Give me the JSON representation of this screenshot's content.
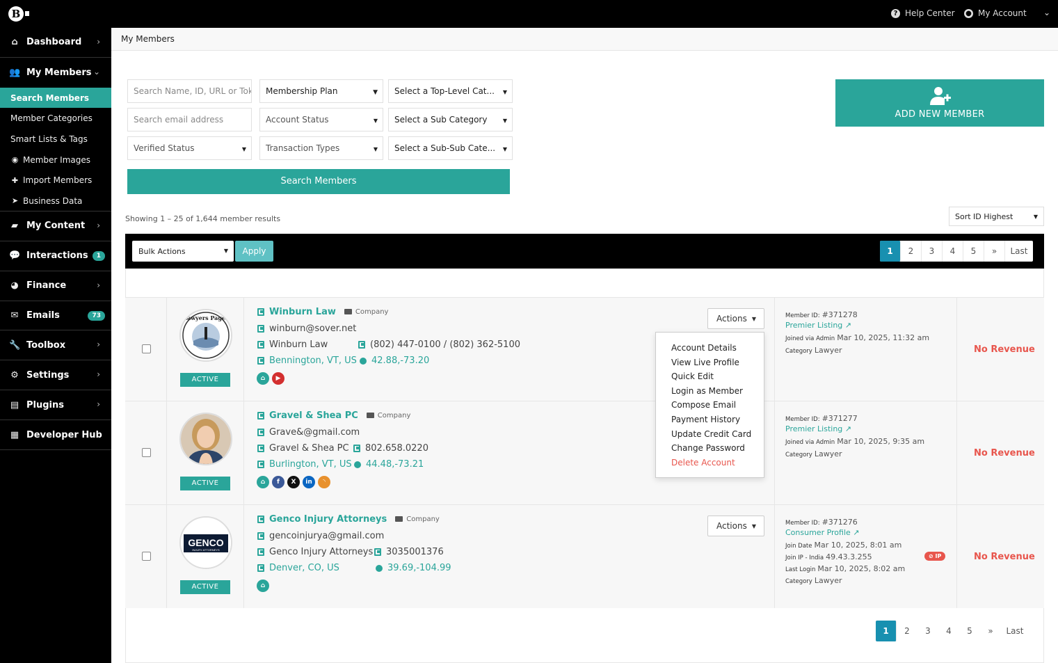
{
  "topbar": {
    "help": "Help Center",
    "account": "My Account"
  },
  "sidebar": {
    "dashboard": "Dashboard",
    "my_members": "My Members",
    "sub": [
      "Search Members",
      "Member Categories",
      "Smart Lists & Tags",
      "Member Images",
      "Import Members",
      "Business Data"
    ],
    "my_content": "My Content",
    "interactions": "Interactions",
    "interactions_badge": "1",
    "finance": "Finance",
    "emails": "Emails",
    "emails_badge": "73",
    "toolbox": "Toolbox",
    "settings": "Settings",
    "plugins": "Plugins",
    "developer_hub": "Developer Hub"
  },
  "breadcrumb": "My Members",
  "filters": {
    "search_placeholder": "Search Name, ID, URL or Tok",
    "email_placeholder": "Search email address",
    "verified": "Verified Status",
    "plan": "Membership Plan",
    "account_status": "Account Status",
    "transaction": "Transaction Types",
    "top_cat": "Select a Top-Level Cat...",
    "sub_cat": "Select a Sub Category",
    "subsub_cat": "Select a Sub-Sub Cate...",
    "search_button": "Search Members"
  },
  "add_member": "ADD NEW MEMBER",
  "showing": "Showing 1 – 25 of 1,644 member results",
  "sort": "Sort ID Highest",
  "bulk": "Bulk Actions",
  "apply": "Apply",
  "pagination": [
    "1",
    "2",
    "3",
    "4",
    "5",
    "»",
    "Last"
  ],
  "members": [
    {
      "name": "Winburn Law",
      "type": "Company",
      "email": "winburn@sover.net",
      "company": "Winburn Law",
      "phone": "(802) 447-0100 / (802) 362-5100",
      "location": "Bennington, VT, US",
      "coords": "42.88,-73.20",
      "status": "ACTIVE",
      "actions": "Actions",
      "member_id": "#371278",
      "plan": "Premier Listing",
      "joined_label": "Joined via Admin",
      "joined": "Mar 10, 2025, 11:32 am",
      "category_label": "Category",
      "category": "Lawyer",
      "revenue": "No Revenue",
      "member_id_label": "Member ID:",
      "avatar_text": "Lawyers Pages"
    },
    {
      "name": "Gravel & Shea PC",
      "type": "Company",
      "email": "Grave&@gmail.com",
      "company": "Gravel & Shea PC",
      "phone": "802.658.0220",
      "location": "Burlington, VT, US",
      "coords": "44.48,-73.21",
      "status": "ACTIVE",
      "member_id": "#371277",
      "plan": "Premier Listing",
      "joined_label": "Joined via Admin",
      "joined": "Mar 10, 2025, 9:35 am",
      "category_label": "Category",
      "category": "Lawyer",
      "revenue": "No Revenue",
      "member_id_label": "Member ID:"
    },
    {
      "name": "Genco Injury Attorneys",
      "type": "Company",
      "email": "gencoinjurya@gmail.com",
      "company": "Genco Injury Attorneys",
      "phone": "3035001376",
      "location": "Denver, CO, US",
      "coords": "39.69,-104.99",
      "status": "ACTIVE",
      "actions": "Actions",
      "member_id": "#371276",
      "plan": "Consumer Profile",
      "join_date_label": "Join Date",
      "join_date": "Mar 10, 2025, 8:01 am",
      "join_ip_label": "Join IP - India",
      "join_ip": "49.43.3.255",
      "last_login_label": "Last Login",
      "last_login": "Mar 10, 2025, 8:02 am",
      "category_label": "Category",
      "category": "Lawyer",
      "revenue": "No Revenue",
      "member_id_label": "Member ID:",
      "ip_badge": "⊘ IP",
      "logo_main": "GENCO",
      "logo_sub": "INJURY ATTORNEYS"
    }
  ],
  "action_menu": [
    "Account Details",
    "View Live Profile",
    "Quick Edit",
    "Login as Member",
    "Compose Email",
    "Payment History",
    "Update Credit Card",
    "Change Password",
    "Delete Account"
  ],
  "colors": {
    "accent": "#2aa59a",
    "danger": "#e8564d",
    "pager_active": "#1890b0"
  }
}
